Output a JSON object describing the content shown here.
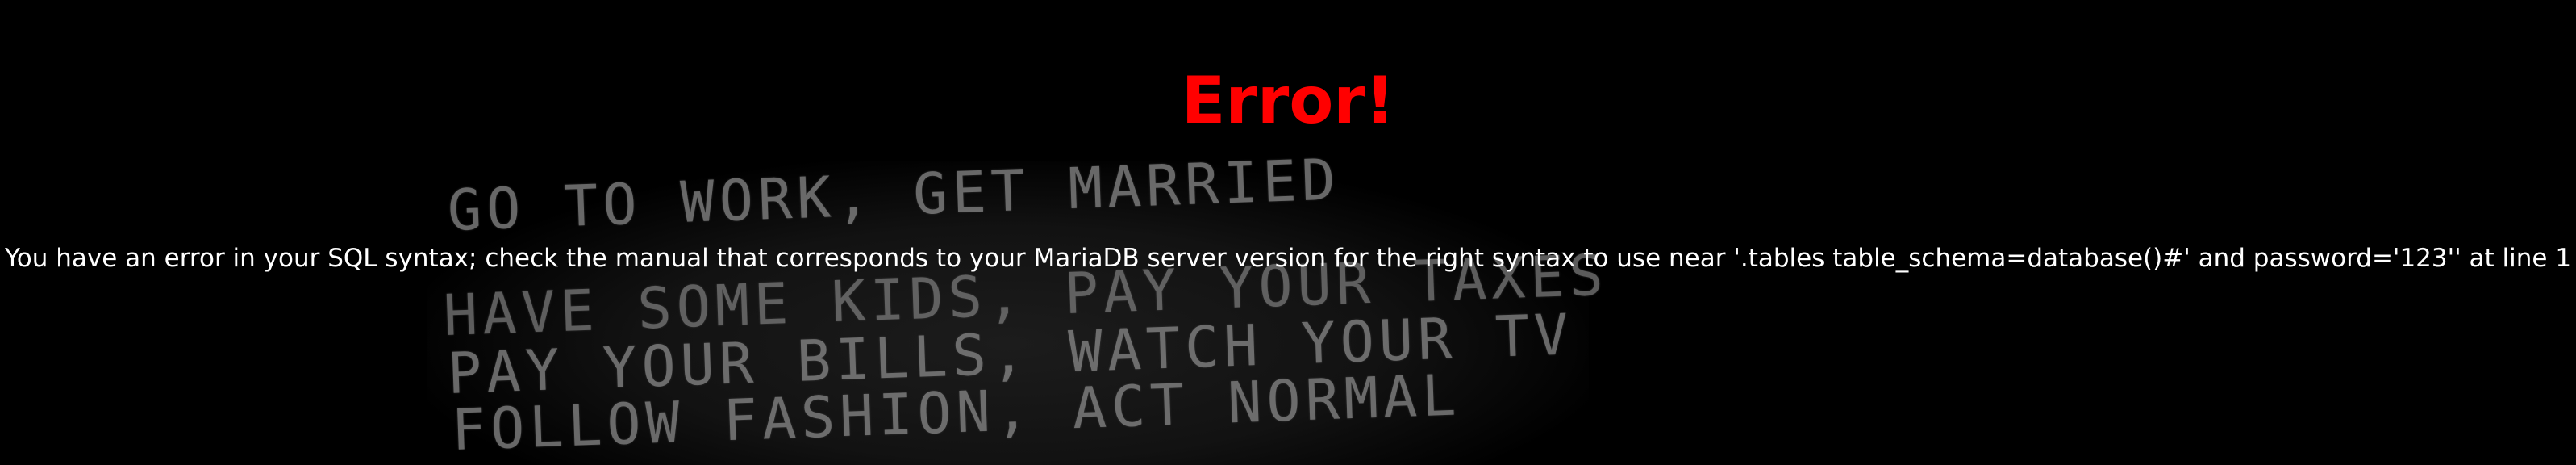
{
  "error": {
    "title": "Error!",
    "message": "You have an error in your SQL syntax; check the manual that corresponds to your MariaDB server version for the right syntax to use near '.tables table_schema=database()#' and password='123'' at line 1"
  },
  "background": {
    "lines": [
      "GO TO WORK, GET MARRIED",
      "HAVE SOME KIDS, PAY YOUR TAXES",
      "PAY YOUR BILLS, WATCH YOUR TV",
      "FOLLOW FASHION, ACT NORMAL"
    ]
  },
  "colors": {
    "background": "#000000",
    "title": "#ff0000",
    "message": "#ffffff"
  }
}
